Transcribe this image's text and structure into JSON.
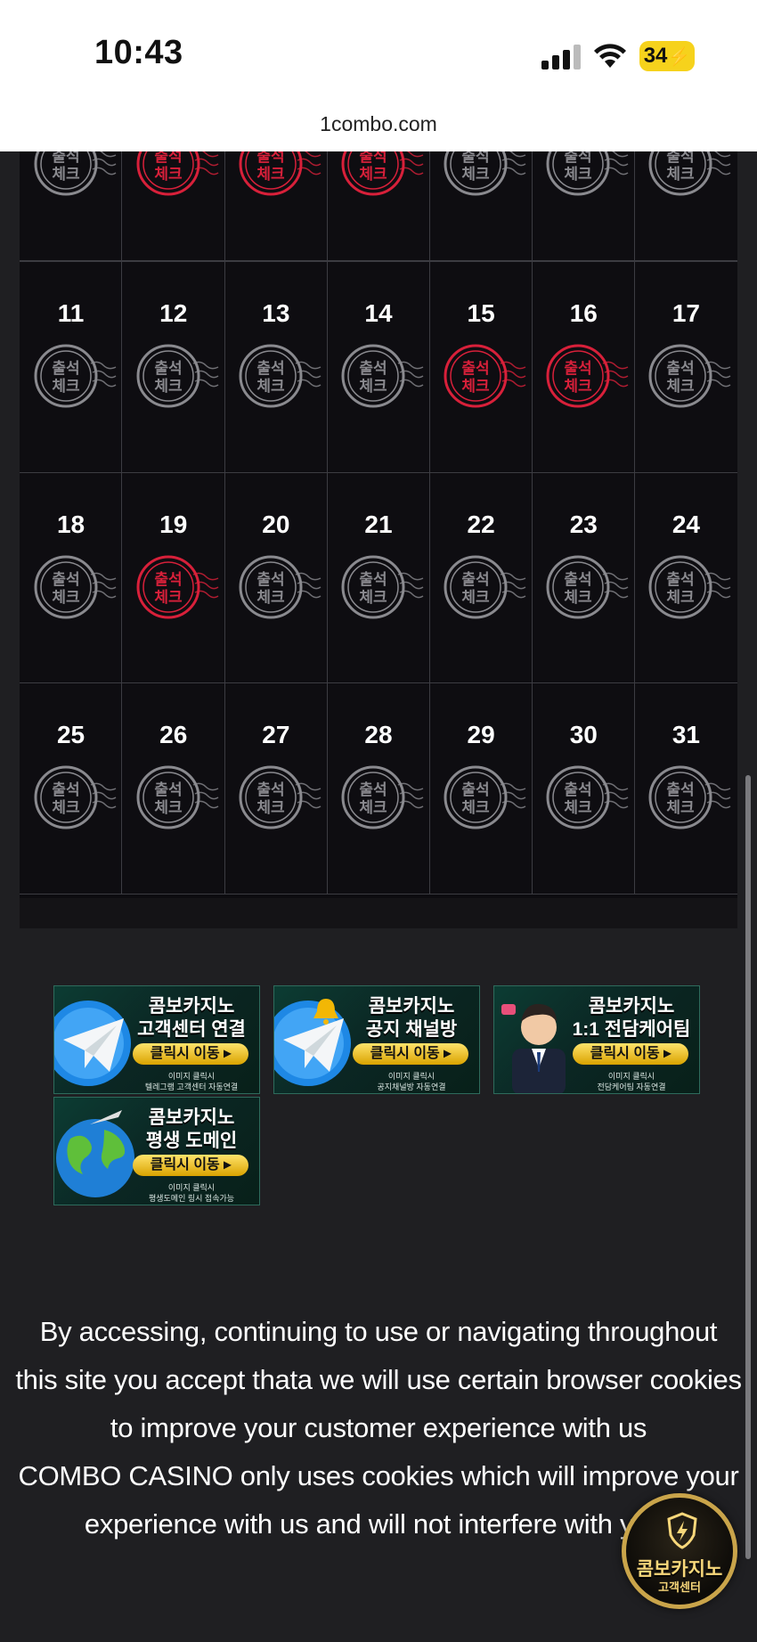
{
  "status_bar": {
    "time": "10:43",
    "battery": "34",
    "battery_color": "#f6d21c"
  },
  "browser": {
    "url": "1combo.com"
  },
  "calendar": {
    "partial_row_stamps": [
      "gray",
      "red",
      "red",
      "red",
      "gray",
      "gray",
      "gray"
    ],
    "rows": [
      [
        {
          "day": "11",
          "stamp": "gray"
        },
        {
          "day": "12",
          "stamp": "gray"
        },
        {
          "day": "13",
          "stamp": "gray"
        },
        {
          "day": "14",
          "stamp": "gray"
        },
        {
          "day": "15",
          "stamp": "red"
        },
        {
          "day": "16",
          "stamp": "red"
        },
        {
          "day": "17",
          "stamp": "gray"
        }
      ],
      [
        {
          "day": "18",
          "stamp": "gray"
        },
        {
          "day": "19",
          "stamp": "red"
        },
        {
          "day": "20",
          "stamp": "gray"
        },
        {
          "day": "21",
          "stamp": "gray"
        },
        {
          "day": "22",
          "stamp": "gray"
        },
        {
          "day": "23",
          "stamp": "gray"
        },
        {
          "day": "24",
          "stamp": "gray"
        }
      ],
      [
        {
          "day": "25",
          "stamp": "gray"
        },
        {
          "day": "26",
          "stamp": "gray"
        },
        {
          "day": "27",
          "stamp": "gray"
        },
        {
          "day": "28",
          "stamp": "gray"
        },
        {
          "day": "29",
          "stamp": "gray"
        },
        {
          "day": "30",
          "stamp": "gray"
        },
        {
          "day": "31",
          "stamp": "gray"
        }
      ]
    ],
    "stamp_text_top": "출석",
    "stamp_text_bottom": "체크",
    "stamp_colors": {
      "red": "#d8203a",
      "gray": "#8a8a8f"
    }
  },
  "banners": [
    {
      "title1": "콤보카지노",
      "title2": "고객센터 연결",
      "button": "클릭시 이동",
      "sub1": "이미지 클릭시",
      "sub2": "텔레그램 고객센터 자동연결",
      "art": "telegram-icon"
    },
    {
      "title1": "콤보카지노",
      "title2": "공지 채널방",
      "button": "클릭시 이동",
      "sub1": "이미지 클릭시",
      "sub2": "공지채널방 자동연결",
      "art": "telegram-bell-icon"
    },
    {
      "title1": "콤보카지노",
      "title2": "1:1 전담케어팀",
      "button": "클릭시 이동",
      "sub1": "이미지 클릭시",
      "sub2": "전담케어팀 자동연결",
      "art": "agent-avatar-icon"
    },
    {
      "title1": "콤보카지노",
      "title2": "평생 도메인",
      "button": "클릭시 이동",
      "sub1": "이미지 클릭시",
      "sub2": "평생도메인 링시 접속가능",
      "art": "globe-icon"
    }
  ],
  "cookie_notice": {
    "lines": [
      "By accessing, continuing to use or navigating throughout",
      "this site you accept thata we will use certain browser cookies",
      "to improve your customer experience with us",
      "COMBO CASINO only uses cookies which will improve your",
      "experience with us and will not interfere with your"
    ]
  },
  "support_badge": {
    "line1": "콤보카지노",
    "line2": "고객센터",
    "color": "#c9a44a"
  }
}
